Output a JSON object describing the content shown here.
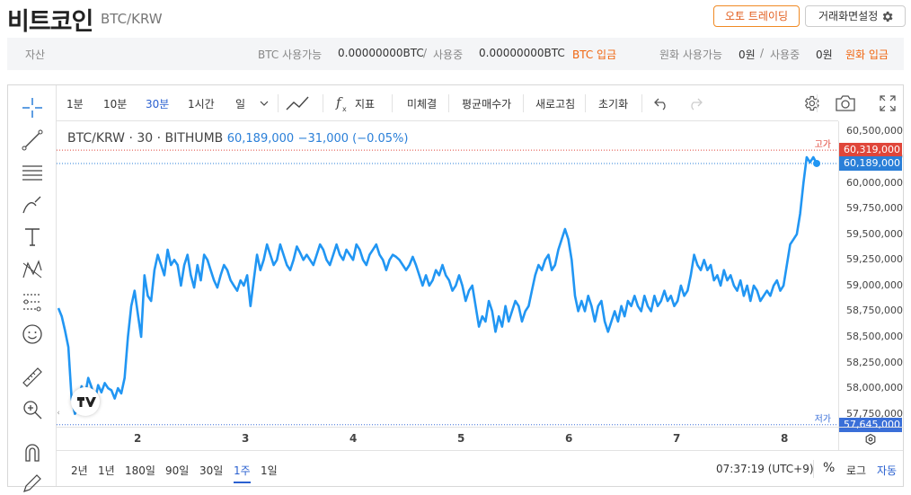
{
  "header": {
    "title": "비트코인",
    "pair": "BTC/KRW",
    "auto_trade_label": "오토 트레이딩",
    "screen_settings_label": "거래화면설정"
  },
  "asset_bar": {
    "label": "자산",
    "btc_available_label": "BTC 사용가능",
    "btc_available_value": "0.00000000BTC",
    "separator": "/",
    "btc_in_use_label": "사용중",
    "btc_in_use_value": "0.00000000BTC",
    "btc_deposit_label": "BTC 입금",
    "krw_available_label": "원화 사용가능",
    "krw_available_value": "0원",
    "krw_in_use_label": "사용중",
    "krw_in_use_value": "0원",
    "krw_deposit_label": "원화 입금"
  },
  "toolbar": {
    "intervals": [
      "1분",
      "10분",
      "30분",
      "1시간",
      "일"
    ],
    "active_interval": "30분",
    "indicators_label": "지표",
    "unfilled_label": "미체결",
    "avg_price_label": "평균매수가",
    "refresh_label": "새로고침",
    "reset_label": "초기화"
  },
  "legend": {
    "symbol": "BTC/KRW · 30 · BITHUMB",
    "price": "60,189,000",
    "change": "−31,000 (−0.05%)"
  },
  "colors": {
    "line": "#2196f3",
    "high_flag": "#e0463a",
    "current_flag": "#2a7fd8",
    "low_flag": "#3a6fd8",
    "accent_orange": "#f0650f",
    "active_blue": "#2a60d0"
  },
  "chart_data": {
    "type": "line",
    "x_ticks": [
      "2",
      "3",
      "4",
      "5",
      "6",
      "7",
      "8"
    ],
    "y_ticks": [
      "60,500,000",
      "60,250,000",
      "60,000,000",
      "59,750,000",
      "59,500,000",
      "59,250,000",
      "59,000,000",
      "58,750,000",
      "58,500,000",
      "58,250,000",
      "58,000,000",
      "57,750,000"
    ],
    "ylim": [
      57625000,
      60600000
    ],
    "high_label": "고가",
    "high_value": "60,319,000",
    "current_value": "60,189,000",
    "low_label": "저가",
    "low_value": "57,645,000",
    "series": [
      {
        "values": [
          58780000,
          58700000,
          58560000,
          58400000,
          57900000,
          57750000,
          57820000,
          58020000,
          57920000,
          58100000,
          58010000,
          57870000,
          58030000,
          57960000,
          58050000,
          58000000,
          57980000,
          57900000,
          58000000,
          57950000,
          58100000,
          58500000,
          58800000,
          58950000,
          58720000,
          58500000,
          59100000,
          58900000,
          58850000,
          59150000,
          59300000,
          59200000,
          59100000,
          59350000,
          59200000,
          59250000,
          59200000,
          59000000,
          59200000,
          59300000,
          59100000,
          58980000,
          59200000,
          59050000,
          59300000,
          59250000,
          59150000,
          59050000,
          58980000,
          59100000,
          59200000,
          59150000,
          59050000,
          59000000,
          58950000,
          59050000,
          59000000,
          59100000,
          58800000,
          59050000,
          59300000,
          59150000,
          59250000,
          59400000,
          59300000,
          59200000,
          59250000,
          59400000,
          59300000,
          59200000,
          59150000,
          59250000,
          59380000,
          59320000,
          59250000,
          59300000,
          59250000,
          59200000,
          59300000,
          59400000,
          59350000,
          59250000,
          59200000,
          59300000,
          59400000,
          59300000,
          59250000,
          59350000,
          59300000,
          59250000,
          59400000,
          59350000,
          59250000,
          59200000,
          59300000,
          59350000,
          59400000,
          59300000,
          59250000,
          59150000,
          59250000,
          59300000,
          59280000,
          59250000,
          59200000,
          59150000,
          59200000,
          59280000,
          59200000,
          59100000,
          59000000,
          59100000,
          59000000,
          59050000,
          59150000,
          59100000,
          59200000,
          59100000,
          59050000,
          58950000,
          59000000,
          59100000,
          59000000,
          58850000,
          58950000,
          59000000,
          58800000,
          58600000,
          58700000,
          58650000,
          58850000,
          58750000,
          58550000,
          58700000,
          58600000,
          58800000,
          58650000,
          58750000,
          58850000,
          58800000,
          58650000,
          58750000,
          58800000,
          58950000,
          59100000,
          59200000,
          59150000,
          59250000,
          59300000,
          59150000,
          59200000,
          59350000,
          59450000,
          59550000,
          59450000,
          59250000,
          58900000,
          58750000,
          58850000,
          58750000,
          58900000,
          58800000,
          58650000,
          58800000,
          58850000,
          58650000,
          58550000,
          58650000,
          58750000,
          58650000,
          58800000,
          58700000,
          58850000,
          58800000,
          58900000,
          58800000,
          58750000,
          58900000,
          58800000,
          58750000,
          58900000,
          58800000,
          58850000,
          58950000,
          58850000,
          58900000,
          58800000,
          58850000,
          59000000,
          58900000,
          58950000,
          59100000,
          59300000,
          59200000,
          59150000,
          59250000,
          59150000,
          59200000,
          59050000,
          59100000,
          59000000,
          59150000,
          59050000,
          59100000,
          59000000,
          58950000,
          59050000,
          58900000,
          59000000,
          58850000,
          59000000,
          58950000,
          58850000,
          58900000,
          58950000,
          58900000,
          59000000,
          59050000,
          58950000,
          59000000,
          59200000,
          59400000,
          59450000,
          59500000,
          59700000,
          60000000,
          60250000,
          60200000,
          60250000,
          60189000
        ]
      }
    ]
  },
  "range_bar": {
    "ranges": [
      "2년",
      "1년",
      "180일",
      "90일",
      "30일",
      "1주",
      "1일"
    ],
    "active_range": "1주",
    "time": "07:37:19 (UTC+9)",
    "percent_label": "%",
    "log_label": "로그",
    "auto_label": "자동"
  }
}
